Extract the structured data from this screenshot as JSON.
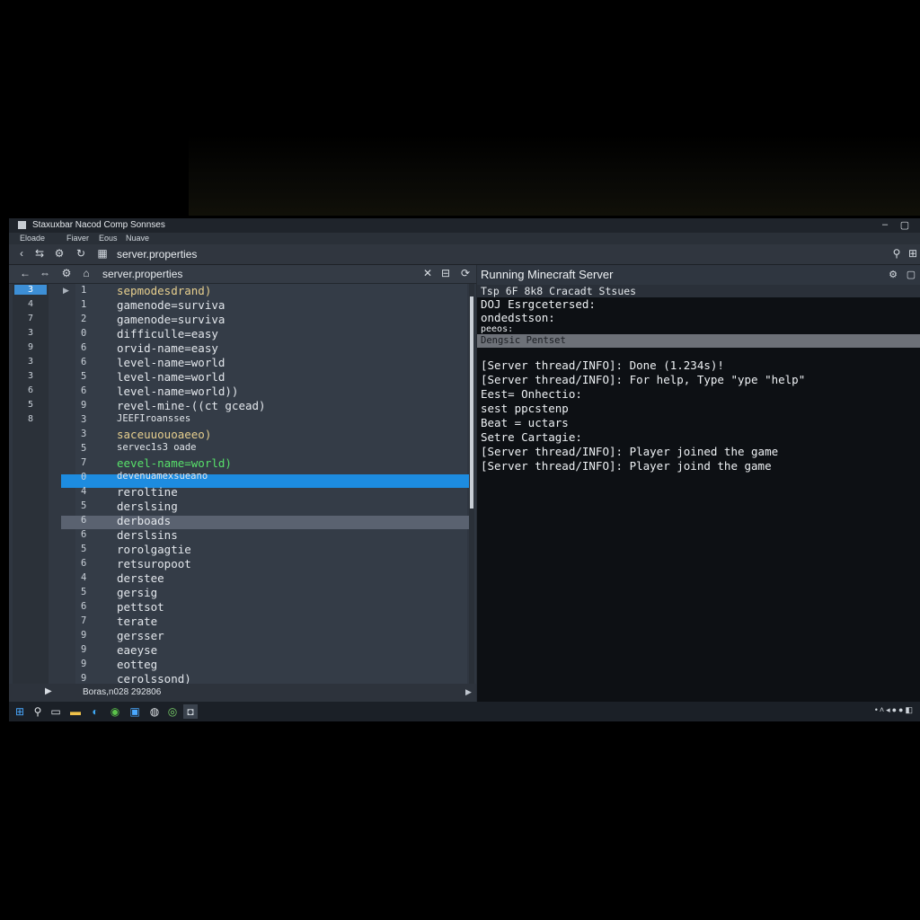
{
  "window": {
    "title": "Staxuxbar Nacod Comp Sonnses",
    "menus": [
      "Eloade",
      "Fiaver",
      "Eous",
      "Nuave"
    ]
  },
  "nav": {
    "address": "server.properties",
    "icons": [
      "back-icon",
      "forward-icon",
      "refresh-icon",
      "grid-icon",
      "settings-icon",
      "menu-icon"
    ]
  },
  "editor": {
    "tab_title": "server.properties",
    "gutter_numbers": [
      "3",
      "4",
      "7",
      "3",
      "9",
      "3",
      "3",
      "6",
      "5",
      "8"
    ],
    "lines": [
      {
        "num": "1",
        "text": "sepmodesdrand)",
        "style": "c-yellow"
      },
      {
        "num": "1",
        "text": "gamenode=surviva",
        "style": ""
      },
      {
        "num": "2",
        "text": "gamenode=surviva",
        "style": ""
      },
      {
        "num": "0",
        "text": "difficulle=easy",
        "style": ""
      },
      {
        "num": "6",
        "text": "orvid-name=easy",
        "style": ""
      },
      {
        "num": "6",
        "text": "level-name=world",
        "style": ""
      },
      {
        "num": "5",
        "text": "level-name=world",
        "style": ""
      },
      {
        "num": "6",
        "text": "level-name=world))",
        "style": ""
      },
      {
        "num": "9",
        "text": "revel-mine-((ct gcead)",
        "style": ""
      },
      {
        "num": "3",
        "text": "JEEFIroansses",
        "style": "small"
      },
      {
        "num": "3",
        "text": "saceuuouoaeeo)",
        "style": "c-yellow"
      },
      {
        "num": "5",
        "text": "servec1s3 oade",
        "style": "small"
      },
      {
        "num": "7",
        "text": "eevel-name=world)",
        "style": "c-green"
      },
      {
        "num": "0",
        "text": "devenuamexsueano",
        "style": "small"
      },
      {
        "num": "4",
        "text": "reroltine",
        "style": ""
      },
      {
        "num": "5",
        "text": "derslsing",
        "style": ""
      },
      {
        "num": "6",
        "text": "derboads",
        "style": ""
      },
      {
        "num": "6",
        "text": "derslsins",
        "style": ""
      },
      {
        "num": "5",
        "text": "rorolgagtie",
        "style": ""
      },
      {
        "num": "6",
        "text": "retsuropoot",
        "style": ""
      },
      {
        "num": "4",
        "text": "derstee",
        "style": ""
      },
      {
        "num": "5",
        "text": "gersig",
        "style": ""
      },
      {
        "num": "6",
        "text": "pettsot",
        "style": ""
      },
      {
        "num": "7",
        "text": "terate",
        "style": ""
      },
      {
        "num": "9",
        "text": "gersser",
        "style": ""
      },
      {
        "num": "9",
        "text": "eaeyse",
        "style": ""
      },
      {
        "num": "9",
        "text": "eotteg",
        "style": ""
      },
      {
        "num": "9",
        "text": "cerolssond)",
        "style": ""
      }
    ],
    "status_text": "Boras,n028 292806"
  },
  "terminal": {
    "title": "Running Minecraft Server",
    "subheader": "Tsp 6F 8k8 Cracadt Stsues",
    "highlight": "Dengsic Pentset",
    "lines_top": [
      "DOJ Esrgcetersed:",
      "ondedstson:",
      "peeos:"
    ],
    "lines": [
      "[Server thread/INFO]: Done (1.234s)!",
      "[Server thread/INFO]: For help, Type \"ype \"help\"",
      "Eest= Onhectio:",
      "sest ppcstenp",
      "Beat = uctars",
      "Setre Cartagie:",
      "[Server thread/INFO]: Player joined the game",
      "[Server thread/INFO]: Player joind the game"
    ]
  },
  "taskbar": {
    "icons": [
      "windows-start-icon",
      "search-icon",
      "task-view-icon",
      "file-explorer-icon",
      "edge-icon",
      "chrome-icon",
      "store-icon",
      "media-icon",
      "steam-icon",
      "minecraft-icon"
    ]
  },
  "colors": {
    "selection_blue": "#1d8ce0",
    "selection_gray": "#5a6270",
    "green_text": "#57e06a",
    "yellow_text": "#e7cf8e"
  }
}
